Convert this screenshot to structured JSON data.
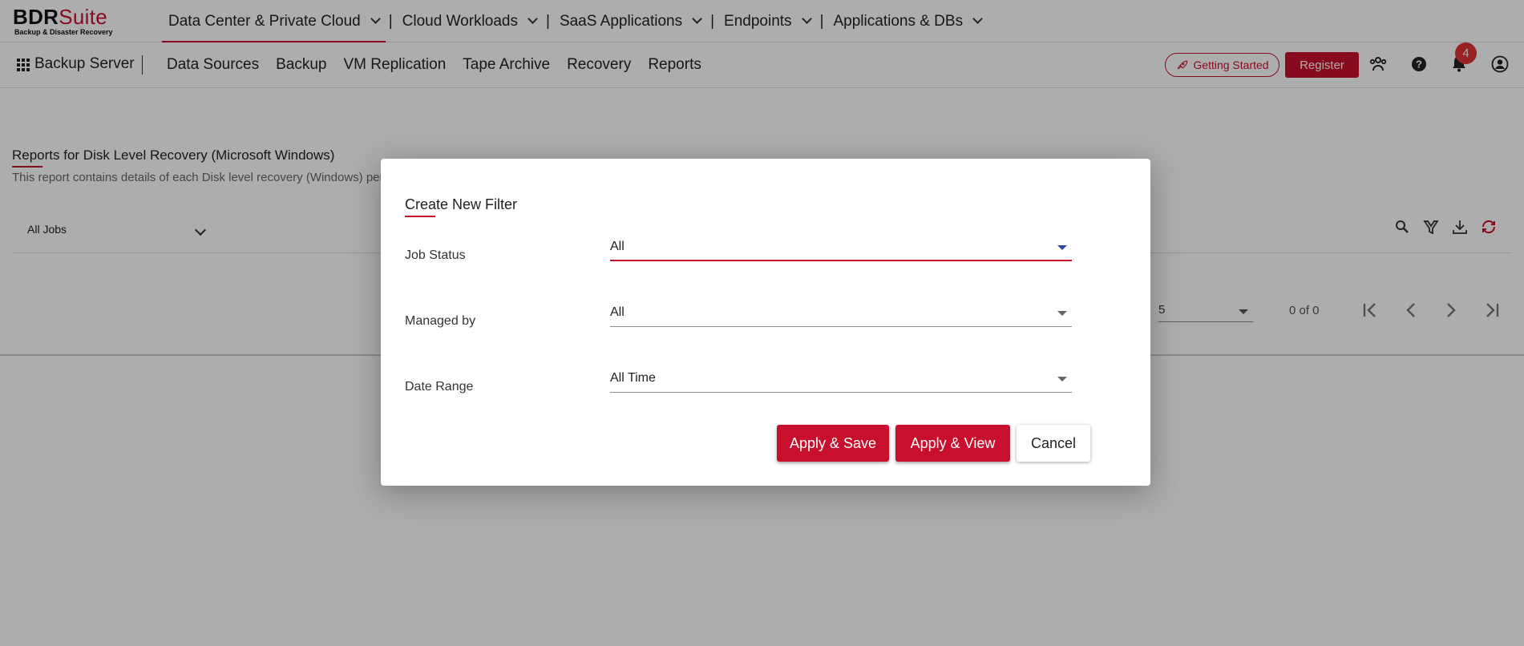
{
  "logo": {
    "brand_part1": "BDR",
    "brand_part2": "Suite",
    "tagline": "Backup & Disaster Recovery"
  },
  "top_nav": [
    {
      "label": "Data Center & Private Cloud"
    },
    {
      "label": "Cloud Workloads"
    },
    {
      "label": "SaaS Applications"
    },
    {
      "label": "Endpoints"
    },
    {
      "label": "Applications & DBs"
    }
  ],
  "top_nav_separator": "|",
  "sub_nav": {
    "title": "Backup Server",
    "items": [
      "Data Sources",
      "Backup",
      "VM Replication",
      "Tape Archive",
      "Recovery",
      "Reports"
    ],
    "getting_started": "Getting Started",
    "register": "Register",
    "notification_count": "4"
  },
  "report": {
    "title": "Reports for Disk Level Recovery (Microsoft Windows)",
    "description": "This report contains details of each Disk level recovery (Windows) perf",
    "jobs_select": "All Jobs"
  },
  "pager": {
    "page_size": "5",
    "count": "0 of 0"
  },
  "modal": {
    "title": "Create New Filter",
    "fields": [
      {
        "label": "Job Status",
        "value": "All"
      },
      {
        "label": "Managed by",
        "value": "All"
      },
      {
        "label": "Date Range",
        "value": "All Time"
      }
    ],
    "buttons": {
      "apply_save": "Apply & Save",
      "apply_view": "Apply & View",
      "cancel": "Cancel"
    }
  },
  "colors": {
    "accent": "#c8102e",
    "badge": "#e03131",
    "overlay": "rgba(0,0,0,0.32)"
  },
  "icons": [
    "grid-icon",
    "rocket-icon",
    "users-icon",
    "help-icon",
    "bell-icon",
    "account-icon",
    "search-icon",
    "filter-icon",
    "download-icon",
    "refresh-icon",
    "first-page-icon",
    "prev-page-icon",
    "next-page-icon",
    "last-page-icon"
  ]
}
